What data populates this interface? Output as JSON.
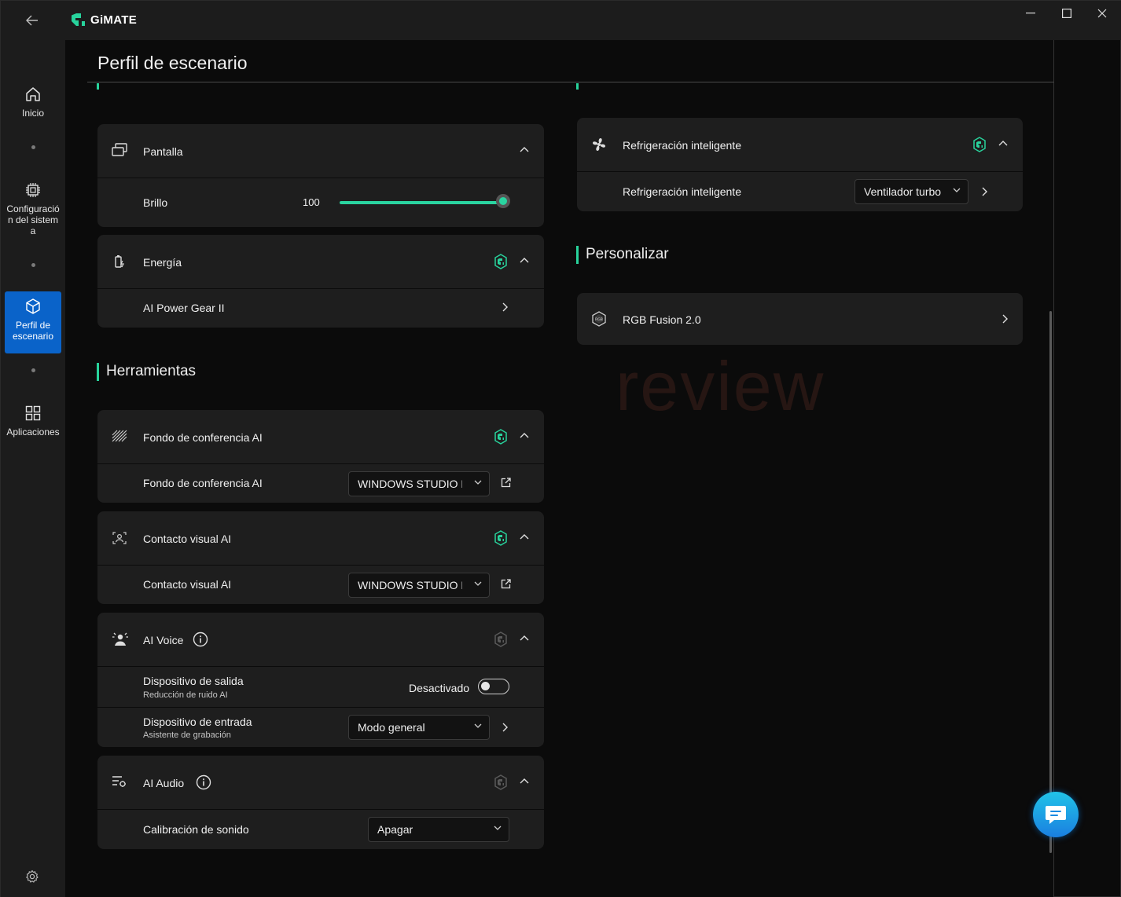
{
  "app": {
    "name": "GiMATE"
  },
  "window_controls": [
    "minimize",
    "maximize",
    "close"
  ],
  "sidebar": {
    "items": [
      {
        "label": "Inicio",
        "icon": "home-icon"
      },
      {
        "label": "Configuración del sistema",
        "icon": "chip-icon"
      },
      {
        "label": "Perfil de escenario",
        "icon": "cube-icon",
        "active": true
      },
      {
        "label": "Aplicaciones",
        "icon": "apps-grid-icon"
      }
    ]
  },
  "page": {
    "title": "Perfil de escenario"
  },
  "left": {
    "pantalla": {
      "title": "Pantalla",
      "brillo_label": "Brillo",
      "brillo_value": "100",
      "brillo_level": 1.0
    },
    "energia": {
      "title": "Energía",
      "item": "AI Power Gear II"
    },
    "herramientas": {
      "heading": "Herramientas"
    },
    "fondo": {
      "title": "Fondo de conferencia AI",
      "row_label": "Fondo de conferencia AI",
      "value": "WINDOWS STUDIO EFFECTS"
    },
    "contacto": {
      "title": "Contacto visual AI",
      "row_label": "Contacto visual AI",
      "value": "WINDOWS STUDIO EFFECTS"
    },
    "voice": {
      "title": "AI Voice",
      "salida_label": "Dispositivo de salida",
      "salida_sub": "Reducción de ruido AI",
      "salida_state": "Desactivado",
      "entrada_label": "Dispositivo de entrada",
      "entrada_sub": "Asistente de grabación",
      "entrada_value": "Modo general"
    },
    "audio": {
      "title": "AI Audio",
      "calib_label": "Calibración de sonido",
      "calib_value": "Apagar"
    }
  },
  "right": {
    "refrig": {
      "title": "Refrigeración inteligente",
      "row_label": "Refrigeración inteligente",
      "value": "Ventilador turbo"
    },
    "personalizar": {
      "heading": "Personalizar"
    },
    "rgb": {
      "title": "RGB Fusion 2.0"
    }
  },
  "colors": {
    "accent": "#28d39c",
    "active_nav": "#0a63c9",
    "card": "#1e1e1e"
  }
}
